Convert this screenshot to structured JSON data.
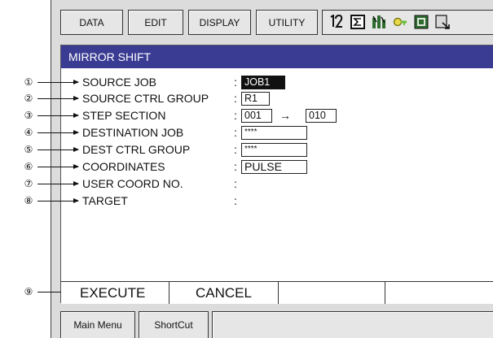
{
  "toolbar": {
    "menus": [
      "DATA",
      "EDIT",
      "DISPLAY",
      "UTILITY"
    ],
    "icons": [
      "robot-group-icon",
      "job-sigma-icon",
      "machine-status-icon",
      "key-security-icon",
      "screen-mode-icon",
      "page-edit-icon"
    ]
  },
  "window": {
    "title": "MIRROR SHIFT",
    "rows": [
      {
        "marker": "①",
        "label": "SOURCE JOB",
        "colon": ":",
        "value": "JOB1"
      },
      {
        "marker": "②",
        "label": "SOURCE CTRL GROUP",
        "colon": ":",
        "value": "R1"
      },
      {
        "marker": "③",
        "label": "STEP SECTION",
        "colon": ":",
        "value_from": "001",
        "arrow": "→",
        "value_to": "010"
      },
      {
        "marker": "④",
        "label": "DESTINATION JOB",
        "colon": ":",
        "value": "****"
      },
      {
        "marker": "⑤",
        "label": "DEST CTRL GROUP",
        "colon": ":",
        "value": "****"
      },
      {
        "marker": "⑥",
        "label": "COORDINATES",
        "colon": ":",
        "value": "PULSE"
      },
      {
        "marker": "⑦",
        "label": "USER COORD NO.",
        "colon": ":"
      },
      {
        "marker": "⑧",
        "label": "TARGET",
        "colon": ":"
      }
    ]
  },
  "execute_bar": {
    "marker": "⑨",
    "execute": "EXECUTE",
    "cancel": "CANCEL"
  },
  "bottom_bar": {
    "main_menu": "Main Menu",
    "shortcut": "ShortCut"
  },
  "colors": {
    "titlebar": "#3a3c93",
    "frame": "#dcdcdc",
    "selected_field": "#111111"
  }
}
